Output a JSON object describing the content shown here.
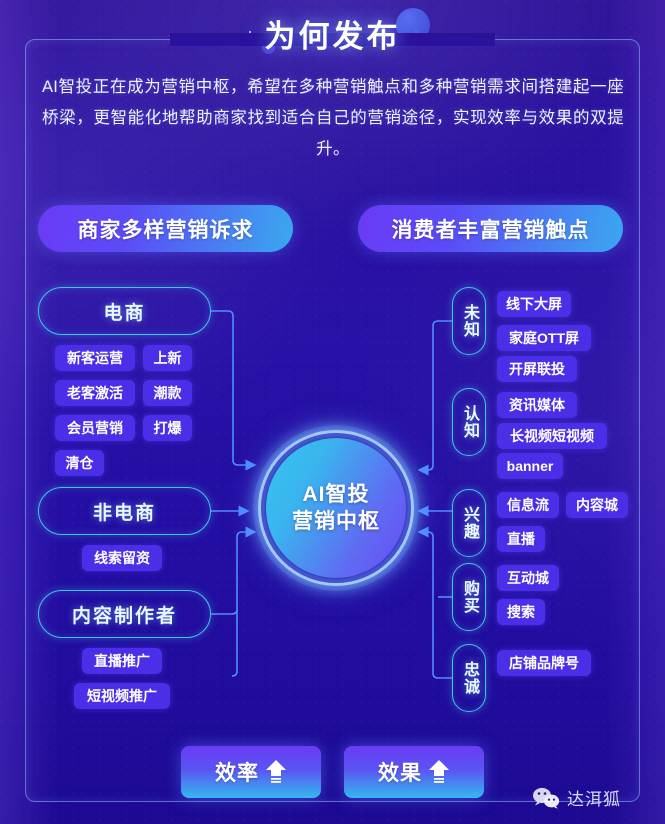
{
  "title": "为何发布",
  "paragraph": "AI智投正在成为营销中枢，希望在多种营销触点和多种营销需求间搭建起一座桥梁，更智能化地帮助商家找到适合自己的营销途径，实现效率与效果的双提升。",
  "header_pills": {
    "merchant": "商家多样营销诉求",
    "consumer": "消费者丰富营销触点"
  },
  "hub": {
    "line1": "AI智投",
    "line2": "营销中枢"
  },
  "left_groups": [
    {
      "label": "电商",
      "tags": [
        "新客运营",
        "上新",
        "老客激活",
        "潮款",
        "会员营销",
        "打爆",
        "清仓"
      ]
    },
    {
      "label": "非电商",
      "tags": [
        "线索留资"
      ]
    },
    {
      "label": "内容制作者",
      "tags": [
        "直播推广",
        "短视频推广"
      ]
    }
  ],
  "right_stages": [
    {
      "label": "未知",
      "tags": [
        "线下大屏",
        "家庭OTT屏",
        "开屏联投"
      ]
    },
    {
      "label": "认知",
      "tags": [
        "资讯媒体",
        "长视频短视频",
        "banner"
      ]
    },
    {
      "label": "兴趣",
      "tags": [
        "信息流",
        "内容城",
        "直播"
      ]
    },
    {
      "label": "购买",
      "tags": [
        "互动城",
        "搜索"
      ]
    },
    {
      "label": "忠诚",
      "tags": [
        "店铺品牌号"
      ]
    }
  ],
  "bottom_buttons": [
    {
      "label": "效率",
      "icon": "arrow-up-icon"
    },
    {
      "label": "效果",
      "icon": "arrow-up-icon"
    }
  ],
  "watermark": {
    "icon": "wechat-icon",
    "label": "达洱狐"
  },
  "colors": {
    "background_top": "#2d1296",
    "background_bottom": "#1c0a92",
    "accent_cyan": "#3fc6e8",
    "accent_violet": "#4b2ee8",
    "pill_gradient_start": "#6a3bf5",
    "pill_gradient_end": "#3aa8ef",
    "frame_border": "#96beff"
  }
}
